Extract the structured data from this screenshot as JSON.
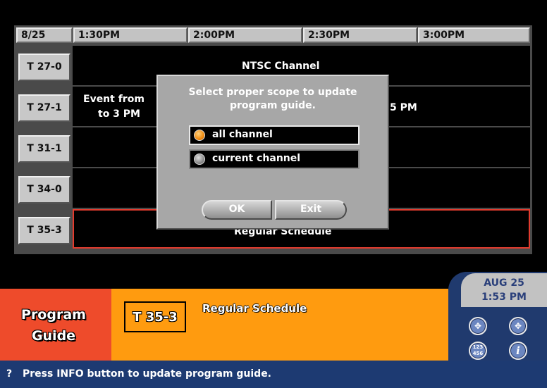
{
  "header": {
    "date": "8/25",
    "times": [
      "1:30PM",
      "2:00PM",
      "2:30PM",
      "3:00PM"
    ]
  },
  "channels": [
    {
      "label": "T 27-0",
      "events": [
        "NTSC Channel"
      ]
    },
    {
      "label": "T 27-1",
      "events": [
        "Event from",
        "to 3 PM",
        "5 PM"
      ]
    },
    {
      "label": "T 31-1",
      "events": []
    },
    {
      "label": "T 34-0",
      "events": []
    },
    {
      "label": "T 35-3",
      "events": [
        "Regular Schedule"
      ]
    }
  ],
  "dialog": {
    "message": "Select proper scope to update program guide.",
    "options": [
      {
        "label": "all channel",
        "selected": true
      },
      {
        "label": "current channel",
        "selected": false
      }
    ],
    "ok_label": "OK",
    "exit_label": "Exit"
  },
  "banner": {
    "title": "Program Guide",
    "channel": "T 35-3",
    "program": "Regular Schedule"
  },
  "clock": {
    "date": "AUG 25",
    "time": "1:53 PM"
  },
  "side_buttons": {
    "numpad": "123 456",
    "info": "i"
  },
  "status": {
    "icon": "?",
    "text": "Press INFO button to update program guide."
  },
  "colors": {
    "accent_orange": "#ff9b0f",
    "banner_red": "#ee4b2b",
    "selected_row": "#e23b2e",
    "navy": "#1d3a72"
  }
}
